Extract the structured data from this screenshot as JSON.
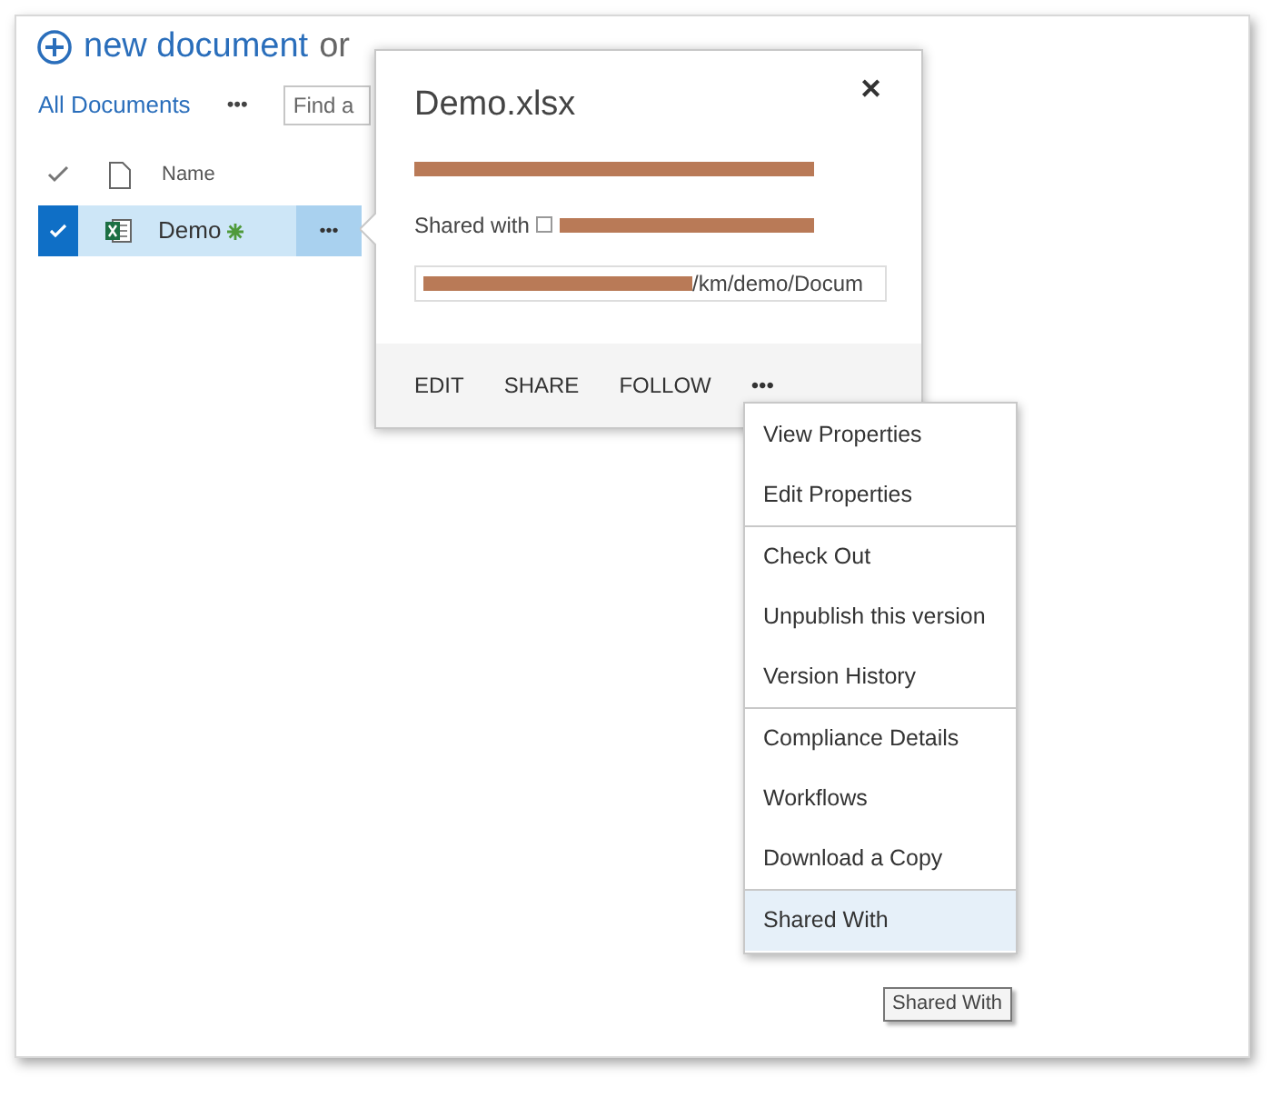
{
  "header": {
    "new_label": "new document",
    "drag_label": "or"
  },
  "toolbar": {
    "view": "All Documents",
    "more": "•••",
    "search": {
      "placeholder": "Find a"
    }
  },
  "list": {
    "columns": [
      {
        "label": "Name"
      }
    ],
    "rows": [
      {
        "name": "Demo",
        "selected": true,
        "new": true,
        "more": "•••"
      }
    ]
  },
  "callout": {
    "title": "Demo.xlsx",
    "close": "✕",
    "changed_line": {
      "redacted": true
    },
    "shared_line": {
      "label": "Shared with",
      "checked": false,
      "redacted": true
    },
    "url": {
      "value": "/km/demo/Docum",
      "redacted": true
    },
    "actions": [
      "EDIT",
      "SHARE",
      "FOLLOW",
      "•••"
    ]
  },
  "menu": {
    "groups": [
      [
        {
          "label": "View Properties",
          "selected": false
        },
        {
          "label": "Edit Properties",
          "selected": false
        }
      ],
      [
        {
          "label": "Check Out",
          "selected": false
        },
        {
          "label": "Unpublish this version",
          "selected": false
        },
        {
          "label": "Version History",
          "selected": false
        }
      ],
      [
        {
          "label": "Compliance Details",
          "selected": false
        },
        {
          "label": "Workflows",
          "selected": false
        },
        {
          "label": "Download a Copy",
          "selected": false
        }
      ],
      [
        {
          "label": "Shared With",
          "selected": true
        }
      ]
    ]
  },
  "tooltip": "Shared With"
}
